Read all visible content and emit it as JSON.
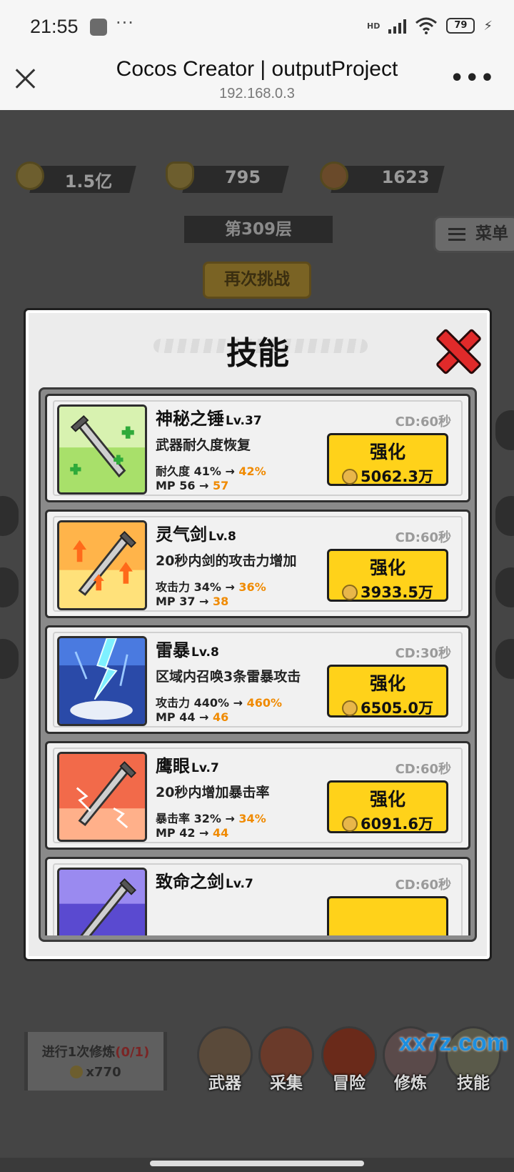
{
  "status_bar": {
    "time": "21:55",
    "dots": "···",
    "network": "HD",
    "battery": "79"
  },
  "browser": {
    "title": "Cocos Creator | outputProject",
    "url": "192.168.0.3",
    "more": "•••"
  },
  "resources": [
    {
      "name": "gold",
      "value": "1.5亿"
    },
    {
      "name": "ingot",
      "value": "795"
    },
    {
      "name": "crane",
      "value": "1623"
    }
  ],
  "floor_label": "第309层",
  "menu_label": "菜单",
  "rechallenge_label": "再次挑战",
  "modal": {
    "title": "技能",
    "skills": [
      {
        "name": "神秘之锤",
        "level": "Lv.37",
        "cd": "CD:60秒",
        "desc": "武器耐久度恢复",
        "stat": "耐久度 41% → ",
        "stat_next": "42%",
        "mp": "MP 56 → ",
        "mp_next": "57",
        "button": "强化",
        "cost": "5062.3万"
      },
      {
        "name": "灵气剑",
        "level": "Lv.8",
        "cd": "CD:60秒",
        "desc": "20秒内剑的攻击力增加",
        "stat": "攻击力 34% → ",
        "stat_next": "36%",
        "mp": "MP 37 → ",
        "mp_next": "38",
        "button": "强化",
        "cost": "3933.5万"
      },
      {
        "name": "雷暴",
        "level": "Lv.8",
        "cd": "CD:30秒",
        "desc": "区域内召唤3条雷暴攻击",
        "stat": "攻击力 440% → ",
        "stat_next": "460%",
        "mp": "MP 44 → ",
        "mp_next": "46",
        "button": "强化",
        "cost": "6505.0万"
      },
      {
        "name": "鹰眼",
        "level": "Lv.7",
        "cd": "CD:60秒",
        "desc": "20秒内增加暴击率",
        "stat": "暴击率 32% → ",
        "stat_next": "34%",
        "mp": "MP 42 → ",
        "mp_next": "44",
        "button": "强化",
        "cost": "6091.6万"
      },
      {
        "name": "致命之剑",
        "level": "Lv.7",
        "cd": "CD:60秒"
      }
    ]
  },
  "training": {
    "text": "进行1次修炼",
    "count": "(0/1)",
    "cost": "x770"
  },
  "nav": [
    {
      "label": "武器"
    },
    {
      "label": "采集"
    },
    {
      "label": "冒险"
    },
    {
      "label": "修炼"
    },
    {
      "label": "技能"
    }
  ],
  "watermark": "xx7z.com",
  "colors": {
    "upgrade_button": "#ffd21a",
    "next_value": "#f08a00",
    "close": "#e02a2a"
  }
}
